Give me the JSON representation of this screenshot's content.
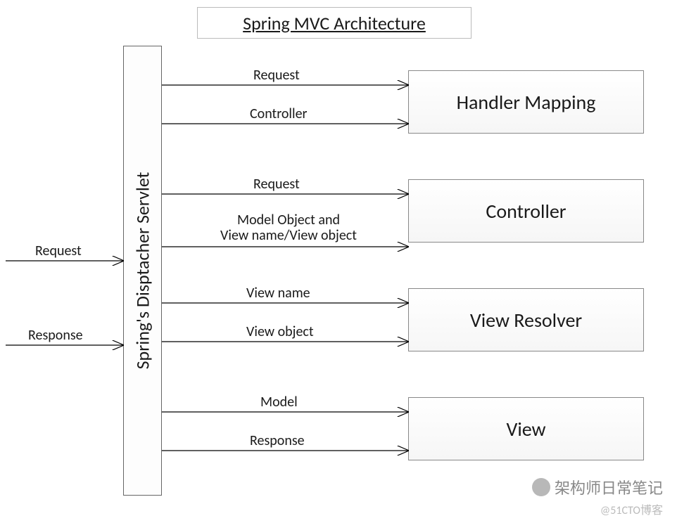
{
  "title": "Spring MVC Architecture",
  "dispatcher": "Spring's Disptacher Servlet",
  "components": {
    "handler_mapping": "Handler Mapping",
    "controller": "Controller",
    "view_resolver": "View Resolver",
    "view": "View"
  },
  "arrows": {
    "in_request": "Request",
    "out_response": "Response",
    "hm_request": "Request",
    "hm_controller": "Controller",
    "ctrl_request": "Request",
    "ctrl_return_l1": "Model Object and",
    "ctrl_return_l2": "View name/View object",
    "vr_viewname": "View name",
    "vr_viewobject": "View object",
    "view_model": "Model",
    "view_response": "Response"
  },
  "watermark": {
    "name": "架构师日常笔记",
    "source": "@51CTO博客"
  }
}
